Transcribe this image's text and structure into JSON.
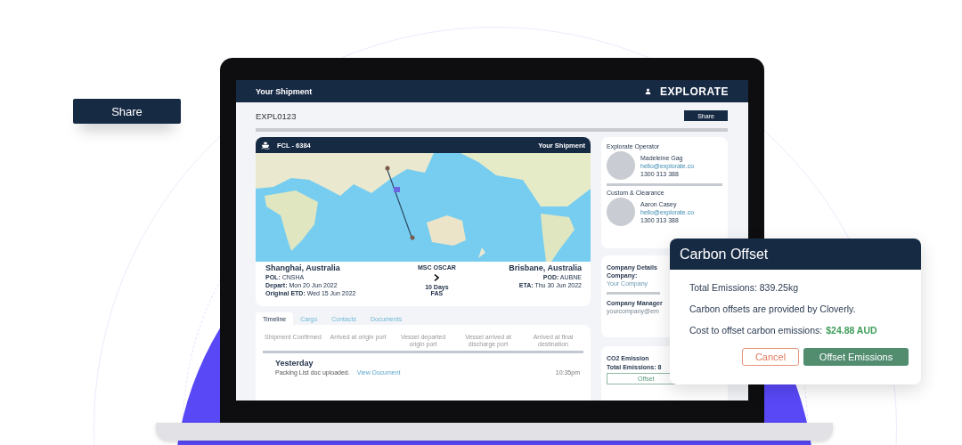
{
  "floating_share_button": {
    "label": "Share"
  },
  "app": {
    "header": {
      "title": "Your Shipment",
      "logo": "EXPLORATE"
    },
    "reference": "EXPL0123",
    "share_button": "Share",
    "shipment": {
      "mode": "FCL - 6384",
      "title": "Your Shipment",
      "origin": {
        "city": "Shanghai, Australia",
        "fields": [
          {
            "label": "POL:",
            "value": "CNSHA"
          },
          {
            "label": "Depart:",
            "value": "Mon 20 Jun 2022"
          },
          {
            "label": "Original ETD:",
            "value": "Wed 15 Jun 2022"
          }
        ]
      },
      "vessel": {
        "name": "MSC OSCAR",
        "duration": "10 Days",
        "status": "FAS"
      },
      "destination": {
        "city": "Brisbane, Australia",
        "fields": [
          {
            "label": "POD:",
            "value": "AUBNE"
          },
          {
            "label": "ETA:",
            "value": "Thu 30 Jun 2022"
          }
        ]
      }
    },
    "tabs": [
      {
        "label": "Timeline",
        "selected": true
      },
      {
        "label": "Cargo",
        "selected": false
      },
      {
        "label": "Contacts",
        "selected": false
      },
      {
        "label": "Documents",
        "selected": false
      }
    ],
    "timeline": {
      "steps": [
        "Shipment Confirmed",
        "Arrived at origin port",
        "Vessel departed origin port",
        "Vessel arrived at discharge port",
        "Arrived at final destination"
      ],
      "events": [
        {
          "day": "Yesterday",
          "text": "Packing List doc uploaded.",
          "link": "View Document",
          "time": "10:35pm"
        }
      ]
    },
    "contacts": [
      {
        "role": "Explorate Operator",
        "name": "Madeleine Gag",
        "email": "hello@explorate.co",
        "phone": "1300 313 388"
      },
      {
        "role": "Custom & Clearance",
        "name": "Aaron Casey",
        "email": "hello@explorate.co",
        "phone": "1300 313 388"
      }
    ],
    "company": {
      "title": "Company Details",
      "company_label": "Company:",
      "company_value": "Your Company",
      "manager_label": "Company Manager",
      "manager_email": "yourcompany@em"
    },
    "co2": {
      "title": "CO2 Emission",
      "total": "Total Emissions: 8",
      "button": "Offset"
    }
  },
  "modal": {
    "title": "Carbon Offset",
    "total": "Total Emissions: 839.25kg",
    "provider": "Carbon offsets are provided by Cloverly.",
    "cost_label": "Cost to offset carbon emissions:",
    "cost": "$24.88 AUD",
    "cancel": "Cancel",
    "confirm": "Offset Emissions"
  }
}
